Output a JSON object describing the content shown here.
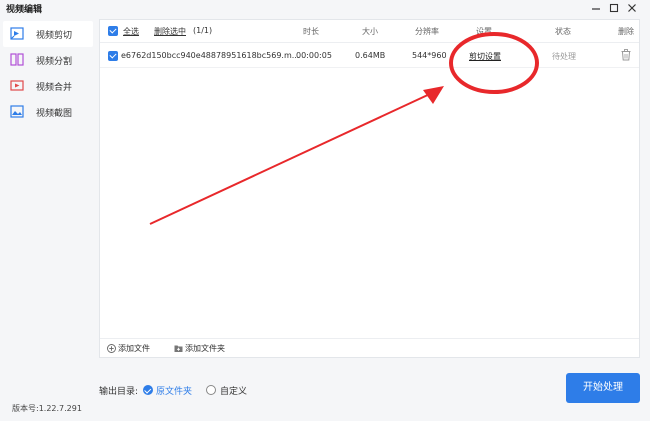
{
  "window": {
    "title": "视频编辑",
    "min_icon": "minimize-icon",
    "max_icon": "maximize-icon",
    "close_icon": "close-icon"
  },
  "sidebar": {
    "items": [
      {
        "label": "视频剪切",
        "icon": "video-cut-icon",
        "active": true
      },
      {
        "label": "视频分割",
        "icon": "video-split-icon",
        "active": false
      },
      {
        "label": "视频合并",
        "icon": "video-merge-icon",
        "active": false
      },
      {
        "label": "视频截图",
        "icon": "video-screenshot-icon",
        "active": false
      }
    ],
    "version": "版本号:1.22.7.291"
  },
  "table": {
    "select_all": "全选",
    "delete_selected": "删除选中",
    "count": "(1/1)",
    "columns": {
      "duration": "时长",
      "size": "大小",
      "resolution": "分辨率",
      "settings": "设置",
      "status": "状态",
      "delete": "删除"
    },
    "rows": [
      {
        "filename": "e6762d150bcc940e48878951618bc569.m...",
        "duration": "00:00:05",
        "size": "0.64MB",
        "resolution": "544*960",
        "settings_link": "剪切设置",
        "status": "待处理"
      }
    ],
    "add_file": "添加文件",
    "add_folder": "添加文件夹"
  },
  "output": {
    "label": "输出目录:",
    "option_source": "原文件夹",
    "option_custom": "自定义"
  },
  "start_button": "开始处理",
  "colors": {
    "accent": "#2e7de8",
    "annotation": "#e8282b"
  }
}
